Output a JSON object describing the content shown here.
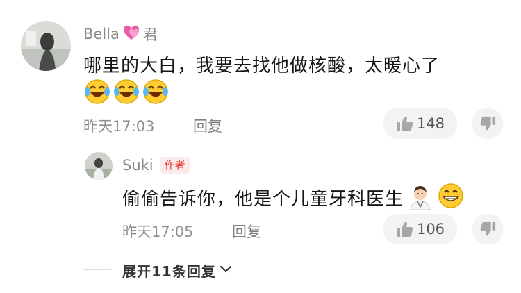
{
  "comment": {
    "author": "Bella",
    "author_suffix": "君",
    "author_emoji_icon": "sparkling-heart-icon",
    "text": "哪里的大白，我要去找他做核酸，太暖心了",
    "emoji_icon": "laughing-tears-emoji",
    "emoji_count": 3,
    "time": "昨天17:03",
    "reply_label": "回复",
    "likes": "148",
    "like_icon": "thumbs-up-icon",
    "dislike_icon": "thumbs-down-icon"
  },
  "reply": {
    "author": "Suki",
    "badge": "作者",
    "text": "偷偷告诉你，他是个儿童牙科医生",
    "emoji_icons": [
      "doctor-emoji",
      "grinning-face-emoji"
    ],
    "time": "昨天17:05",
    "reply_label": "回复",
    "likes": "106",
    "like_icon": "thumbs-up-icon",
    "dislike_icon": "thumbs-down-icon"
  },
  "expand": {
    "label": "展开11条回复",
    "icon": "chevron-down-icon"
  },
  "colors": {
    "badge_text": "#e5322d",
    "badge_bg": "#fdeaea",
    "pill_bg": "#f3f3f3",
    "meta_text": "#8f8f8f"
  }
}
